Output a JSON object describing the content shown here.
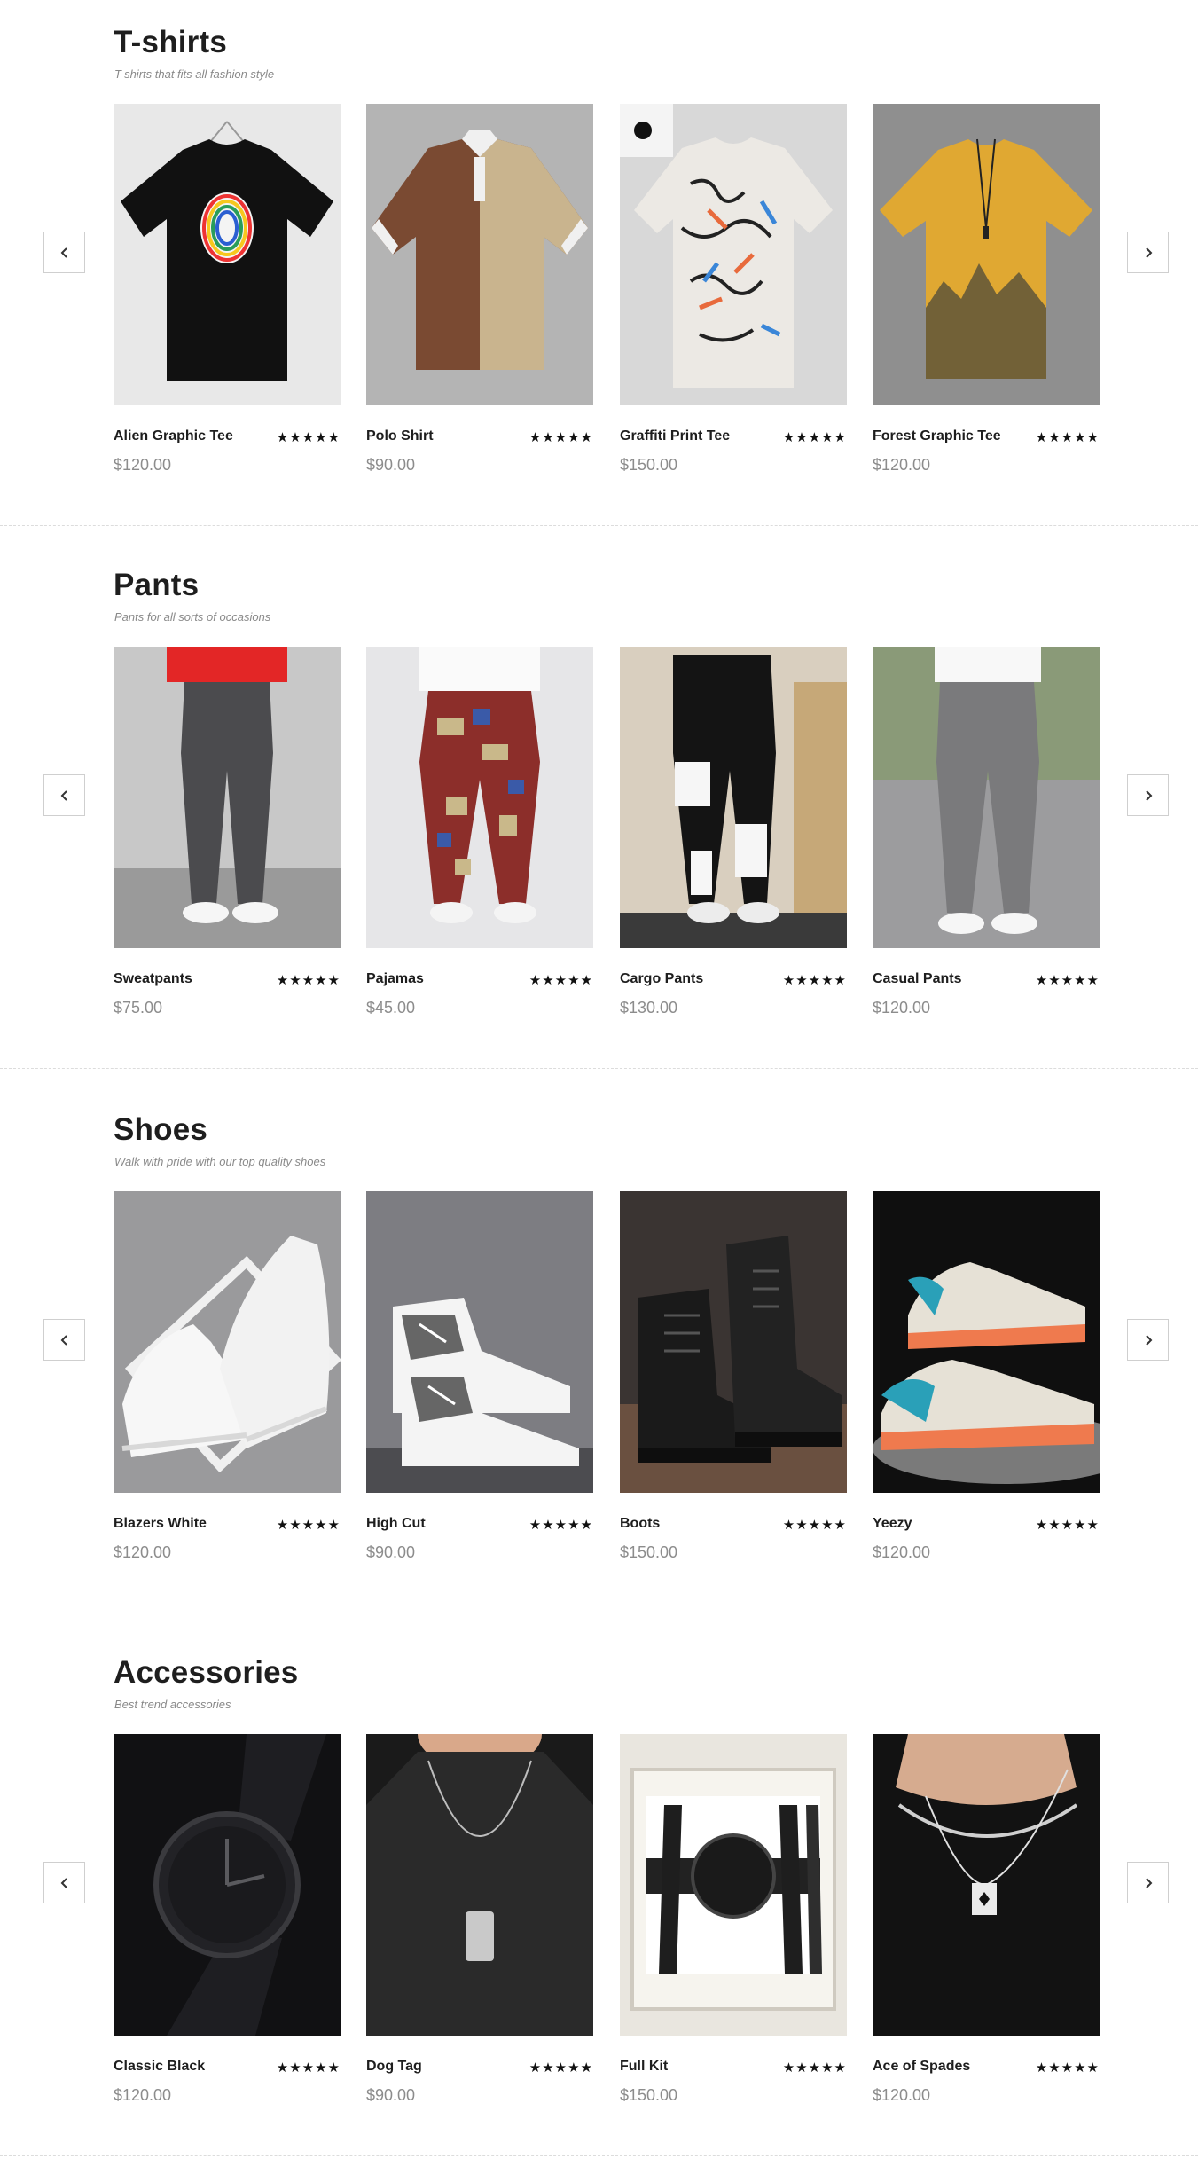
{
  "sections": [
    {
      "title": "T-shirts",
      "subtitle": "T-shirts that fits all fashion style",
      "products": [
        {
          "name": "Alien Graphic Tee",
          "price": "$120.00",
          "rating": "★★★★★"
        },
        {
          "name": "Polo Shirt",
          "price": "$90.00",
          "rating": "★★★★★"
        },
        {
          "name": "Graffiti Print Tee",
          "price": "$150.00",
          "rating": "★★★★★"
        },
        {
          "name": "Forest Graphic Tee",
          "price": "$120.00",
          "rating": "★★★★★"
        }
      ]
    },
    {
      "title": "Pants",
      "subtitle": "Pants for all sorts of occasions",
      "products": [
        {
          "name": "Sweatpants",
          "price": "$75.00",
          "rating": "★★★★★"
        },
        {
          "name": "Pajamas",
          "price": "$45.00",
          "rating": "★★★★★"
        },
        {
          "name": "Cargo Pants",
          "price": "$130.00",
          "rating": "★★★★★"
        },
        {
          "name": "Casual Pants",
          "price": "$120.00",
          "rating": "★★★★★"
        }
      ]
    },
    {
      "title": "Shoes",
      "subtitle": "Walk with pride with our top quality shoes",
      "products": [
        {
          "name": "Blazers White",
          "price": "$120.00",
          "rating": "★★★★★"
        },
        {
          "name": "High Cut",
          "price": "$90.00",
          "rating": "★★★★★"
        },
        {
          "name": "Boots",
          "price": "$150.00",
          "rating": "★★★★★"
        },
        {
          "name": "Yeezy",
          "price": "$120.00",
          "rating": "★★★★★"
        }
      ]
    },
    {
      "title": "Accessories",
      "subtitle": "Best trend accessories",
      "products": [
        {
          "name": "Classic Black",
          "price": "$120.00",
          "rating": "★★★★★"
        },
        {
          "name": "Dog Tag",
          "price": "$90.00",
          "rating": "★★★★★"
        },
        {
          "name": "Full Kit",
          "price": "$150.00",
          "rating": "★★★★★"
        },
        {
          "name": "Ace of Spades",
          "price": "$120.00",
          "rating": "★★★★★"
        }
      ]
    }
  ],
  "nav": {
    "prev_icon": "chevron-left-icon",
    "next_icon": "chevron-right-icon"
  },
  "colors": {
    "text": "#1e1e1e",
    "price": "#8c8c8c",
    "subtitle": "#8a8a8a",
    "divider": "#dcdcdc"
  }
}
